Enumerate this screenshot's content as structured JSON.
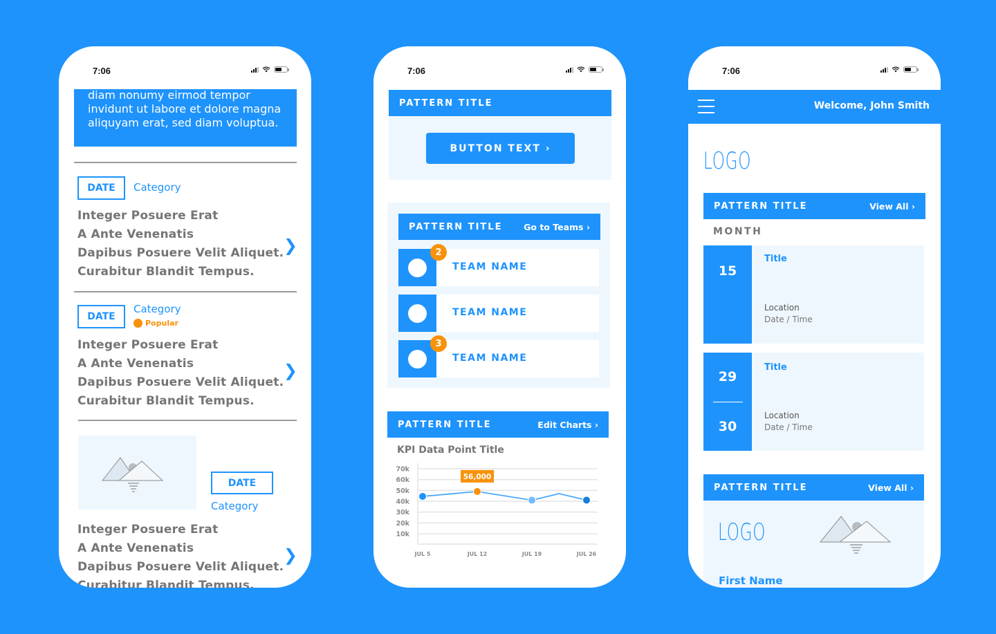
{
  "colors": {
    "background": "#1e93fc",
    "accent": "#1e93fc",
    "orange": "#f7920a",
    "light_panel": "#eef7fe",
    "gray_text": "#757575"
  },
  "status_bar": {
    "time": "7:06",
    "icons": [
      "signal-icon",
      "wifi-icon",
      "battery-icon"
    ]
  },
  "phone1": {
    "banner_lines": [
      "diam nonumy eirmod tempor",
      "invidunt ut labore et dolore magna",
      "aliquyam erat, sed diam voluptua."
    ],
    "articles": [
      {
        "date": "DATE",
        "category": "Category",
        "badge": null,
        "lines": [
          "Integer Posuere Erat",
          "A Ante Venenatis",
          "Dapibus Posuere Velit Aliquet.",
          "Curabitur Blandit Tempus."
        ],
        "chevron": "❯"
      },
      {
        "date": "DATE",
        "category": "Category",
        "badge": "Popular",
        "lines": [
          "Integer Posuere Erat",
          "A Ante Venenatis",
          "Dapibus Posuere Velit Aliquet.",
          "Curabitur Blandit Tempus."
        ],
        "chevron": "❯"
      },
      {
        "date": "DATE",
        "category": "Category",
        "badge": null,
        "image": "image-placeholder-icon",
        "lines": [
          "Integer Posuere Erat",
          "A Ante Venenatis",
          "Dapibus Posuere Velit Aliquet.",
          "Curabitur Blandit Tempus."
        ],
        "chevron": "❯"
      }
    ]
  },
  "phone2": {
    "section1": {
      "title": "PATTERN TITLE",
      "button": "BUTTON TEXT ›"
    },
    "section2": {
      "title": "PATTERN TITLE",
      "link": "Go to Teams ›",
      "teams": [
        {
          "name": "TEAM NAME",
          "badge": "2"
        },
        {
          "name": "TEAM NAME",
          "badge": null
        },
        {
          "name": "TEAM NAME",
          "badge": "3"
        }
      ]
    },
    "section3": {
      "title": "PATTERN TITLE",
      "link": "Edit Charts ›",
      "kpi_title": "KPI Data Point Title"
    }
  },
  "chart_data": {
    "type": "line",
    "title": "KPI Data Point Title",
    "xlabel": "",
    "ylabel": "",
    "x": [
      "JUL 5",
      "",
      "JUL 12",
      "",
      "JUL 19",
      "",
      "JUL 26"
    ],
    "x_ticks": [
      "JUL 5",
      "JUL 12",
      "JUL 19",
      "JUL 26"
    ],
    "x_positions": [
      0,
      1,
      2,
      2.975,
      3
    ],
    "points": [
      {
        "label": "JUL 5",
        "x": 0,
        "y": 44500,
        "marker": true,
        "color": "#1e93fc"
      },
      {
        "label": "JUL 12",
        "x": 1,
        "y": 49000,
        "marker": true,
        "color": "#f7920a",
        "highlight": true
      },
      {
        "label": "JUL 19",
        "x": 2,
        "y": 41000,
        "marker": true,
        "color": "#74bcfb"
      },
      {
        "label": "",
        "x": 2.5,
        "y": 47000,
        "marker": false
      },
      {
        "label": "JUL 26",
        "x": 3,
        "y": 41000,
        "marker": true,
        "color": "#1a7fd9"
      }
    ],
    "annotation": {
      "text": "56,000",
      "at": "JUL 12"
    },
    "y_ticks": [
      "10k",
      "20k",
      "30k",
      "40k",
      "50k",
      "60k",
      "70k"
    ],
    "ylim": [
      0,
      75000
    ],
    "grid": true,
    "legend": "none"
  },
  "phone3": {
    "welcome": "Welcome, John Smith",
    "logo": "LOGO",
    "events": {
      "title": "PATTERN TITLE",
      "link": "View All ›",
      "month": "MONTH",
      "items": [
        {
          "days": [
            "15"
          ],
          "title": "Title",
          "location": "Location",
          "datetime": "Date / Time"
        },
        {
          "days": [
            "29",
            "30"
          ],
          "title": "Title",
          "location": "Location",
          "datetime": "Date / Time"
        }
      ]
    },
    "profile": {
      "title": "PATTERN TITLE",
      "link": "View All ›",
      "logo": "LOGO",
      "first_name": "First Name"
    }
  }
}
